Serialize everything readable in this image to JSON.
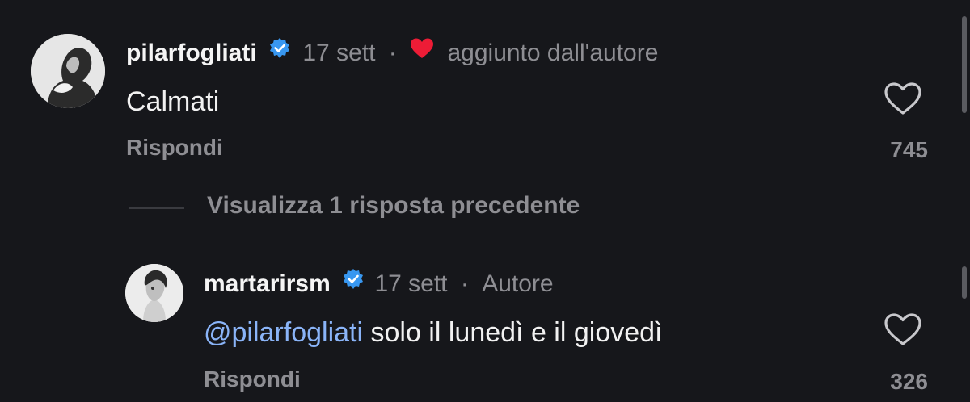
{
  "comments": {
    "top": {
      "username": "pilarfogliati",
      "time": "17 sett",
      "separator": "·",
      "liked_by_author": "aggiunto dall'autore",
      "text": "Calmati",
      "reply_label": "Rispondi",
      "like_count": "745"
    },
    "view_replies_label": "Visualizza 1 risposta precedente",
    "reply": {
      "username": "martarirsm",
      "time": "17 sett",
      "separator": "·",
      "role_badge": "Autore",
      "mention": "@pilarfogliati",
      "text": " solo il lunedì e il giovedì",
      "reply_label": "Rispondi",
      "like_count": "326"
    }
  },
  "icons": {
    "verified": "verified-badge-icon",
    "heart": "heart-outline-icon",
    "liked": "heart-filled-icon"
  },
  "colors": {
    "background": "#16171b",
    "verified": "#3897f0",
    "author_heart": "#ed1c36",
    "mention": "#8ab4f8",
    "muted": "#8e8e93"
  }
}
